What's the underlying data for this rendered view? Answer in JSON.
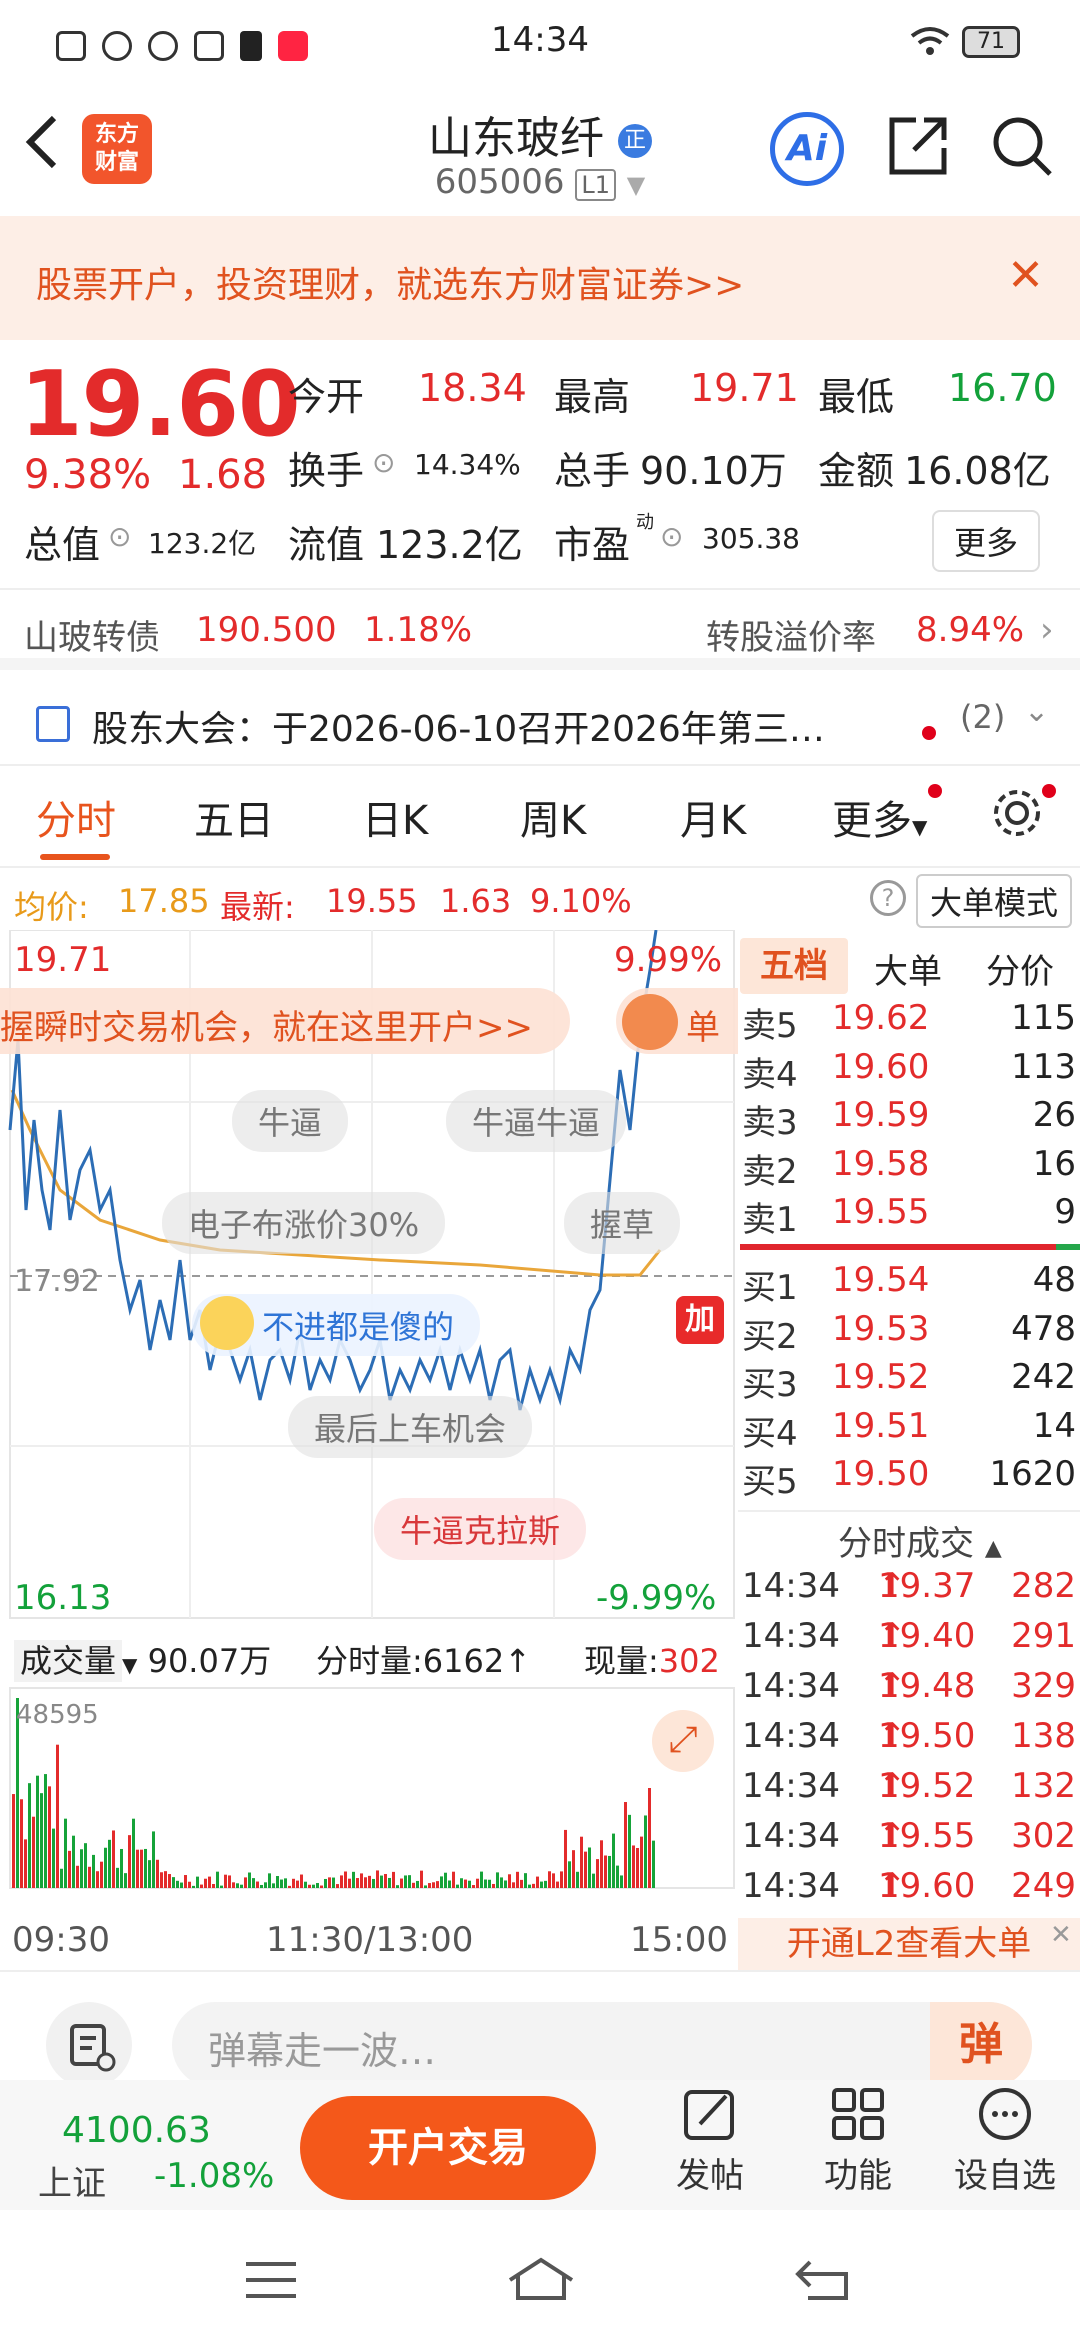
{
  "status": {
    "time": "14:34",
    "battery": "71"
  },
  "header": {
    "name": "山东玻纤",
    "badge": "正",
    "code": "605006",
    "level": "L1",
    "logo_top": "东方",
    "logo_bottom": "财富",
    "ai": "Ai"
  },
  "banner": {
    "text": "股票开户，投资理财，就选东方财富证券>>"
  },
  "quote": {
    "price": "19.60",
    "pct": "9.38%",
    "change": "1.68",
    "open_label": "今开",
    "open": "18.34",
    "high_label": "最高",
    "high": "19.71",
    "low_label": "最低",
    "low": "16.70",
    "turnover_label": "换手",
    "turnover": "14.34%",
    "volume_label": "总手",
    "volume": "90.10万",
    "amount_label": "金额",
    "amount": "16.08亿",
    "mktcap_label": "总值",
    "mktcap": "123.2亿",
    "float_label": "流值",
    "float": "123.2亿",
    "pe_label": "市盈",
    "pe_sup": "动",
    "pe": "305.38",
    "more": "更多"
  },
  "bond": {
    "name": "山玻转债",
    "price": "190.500",
    "pct": "1.18%",
    "premium_label": "转股溢价率",
    "premium": "8.94%"
  },
  "meeting": {
    "text": "股东大会：于2026-06-10召开2026年第三…",
    "count": "(2)"
  },
  "tabs": [
    "分时",
    "五日",
    "日K",
    "周K",
    "月K",
    "更多"
  ],
  "avgline": {
    "avg_label": "均价:",
    "avg": "17.85",
    "latest_label": "最新:",
    "latest": "19.55",
    "chg": "1.63",
    "pct": "9.10%",
    "mode": "大单模式"
  },
  "chart": {
    "y_top": "19.71",
    "y_top_pct": "9.99%",
    "y_mid": "17.92",
    "y_bot": "16.13",
    "y_bot_pct": "-9.99%",
    "vol_label": "成交量",
    "vol_total": "90.07万",
    "fen_label": "分时量:",
    "fen_val": "6162",
    "now_label": "现量:",
    "now_val": "302",
    "vol_max": "48595",
    "x_labels": [
      "09:30",
      "11:30/13:00",
      "15:00"
    ],
    "danmu": [
      "握瞬时交易机会，就在这里开户>>",
      "牛逼",
      "牛逼牛逼",
      "电子布涨价30%",
      "握草",
      "不进都是傻的",
      "最后上车机会",
      "牛逼克拉斯",
      "单"
    ],
    "add_btn": "加"
  },
  "orderbook": {
    "tabs": [
      "五档",
      "大单",
      "分价"
    ],
    "asks": [
      {
        "label": "卖5",
        "price": "19.62",
        "vol": "115"
      },
      {
        "label": "卖4",
        "price": "19.60",
        "vol": "113"
      },
      {
        "label": "卖3",
        "price": "19.59",
        "vol": "26"
      },
      {
        "label": "卖2",
        "price": "19.58",
        "vol": "16"
      },
      {
        "label": "卖1",
        "price": "19.55",
        "vol": "9"
      }
    ],
    "bids": [
      {
        "label": "买1",
        "price": "19.54",
        "vol": "48"
      },
      {
        "label": "买2",
        "price": "19.53",
        "vol": "478"
      },
      {
        "label": "买3",
        "price": "19.52",
        "vol": "242"
      },
      {
        "label": "买4",
        "price": "19.51",
        "vol": "14"
      },
      {
        "label": "买5",
        "price": "19.50",
        "vol": "1620"
      }
    ],
    "trades_title": "分时成交",
    "trades": [
      {
        "time": "14:34",
        "price": "19.37",
        "vol": "282"
      },
      {
        "time": "14:34",
        "price": "19.40",
        "vol": "291"
      },
      {
        "time": "14:34",
        "price": "19.48",
        "vol": "329"
      },
      {
        "time": "14:34",
        "price": "19.50",
        "vol": "138"
      },
      {
        "time": "14:34",
        "price": "19.52",
        "vol": "132"
      },
      {
        "time": "14:34",
        "price": "19.55",
        "vol": "302"
      },
      {
        "time": "14:34",
        "price": "19.60",
        "vol": "249"
      }
    ],
    "l2": "开通L2查看大单"
  },
  "danmu_input": {
    "placeholder": "弹幕走一波…",
    "btn": "弹"
  },
  "footer": {
    "index_value": "4100.63",
    "index_name": "上证",
    "index_pct": "-1.08%",
    "trade_btn": "开户交易",
    "post": "发帖",
    "func": "功能",
    "watch": "设自选"
  }
}
